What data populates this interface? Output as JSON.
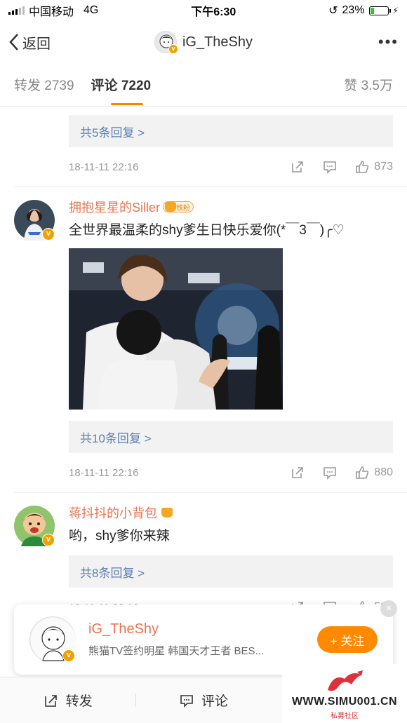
{
  "status": {
    "carrier": "中国移动",
    "network": "4G",
    "time": "下午6:30",
    "battery": "23%",
    "battery_level": 0.23
  },
  "nav": {
    "back_label": "返回",
    "title": "iG_TheShy"
  },
  "tabs": {
    "repost": "转发 2739",
    "comment": "评论 7220",
    "like": "赞 3.5万"
  },
  "comments": [
    {
      "replies": "共5条回复 >",
      "time": "18-11-11 22:16",
      "likes": "873"
    },
    {
      "name": "拥抱星星的Siller",
      "badge": "铁粉",
      "text": "全世界最温柔的shy爹生日快乐爱你(*￣3￣)╭♡",
      "replies": "共10条回复 >",
      "time": "18-11-11 22:16",
      "likes": "880"
    },
    {
      "name": "蒋抖抖的小背包",
      "text": "哟，shy爹你来辣",
      "replies": "共8条回复 >",
      "time": "18-11-11 22:16",
      "likes": "594"
    }
  ],
  "follow_card": {
    "name": "iG_TheShy",
    "desc": "熊猫TV签约明星 韩国天才王者 BES...",
    "button": "+ 关注"
  },
  "bottom": {
    "repost": "转发",
    "comment": "评论"
  },
  "watermark": {
    "site": "WWW.SIMU001.CN",
    "sub": "私募社区"
  }
}
